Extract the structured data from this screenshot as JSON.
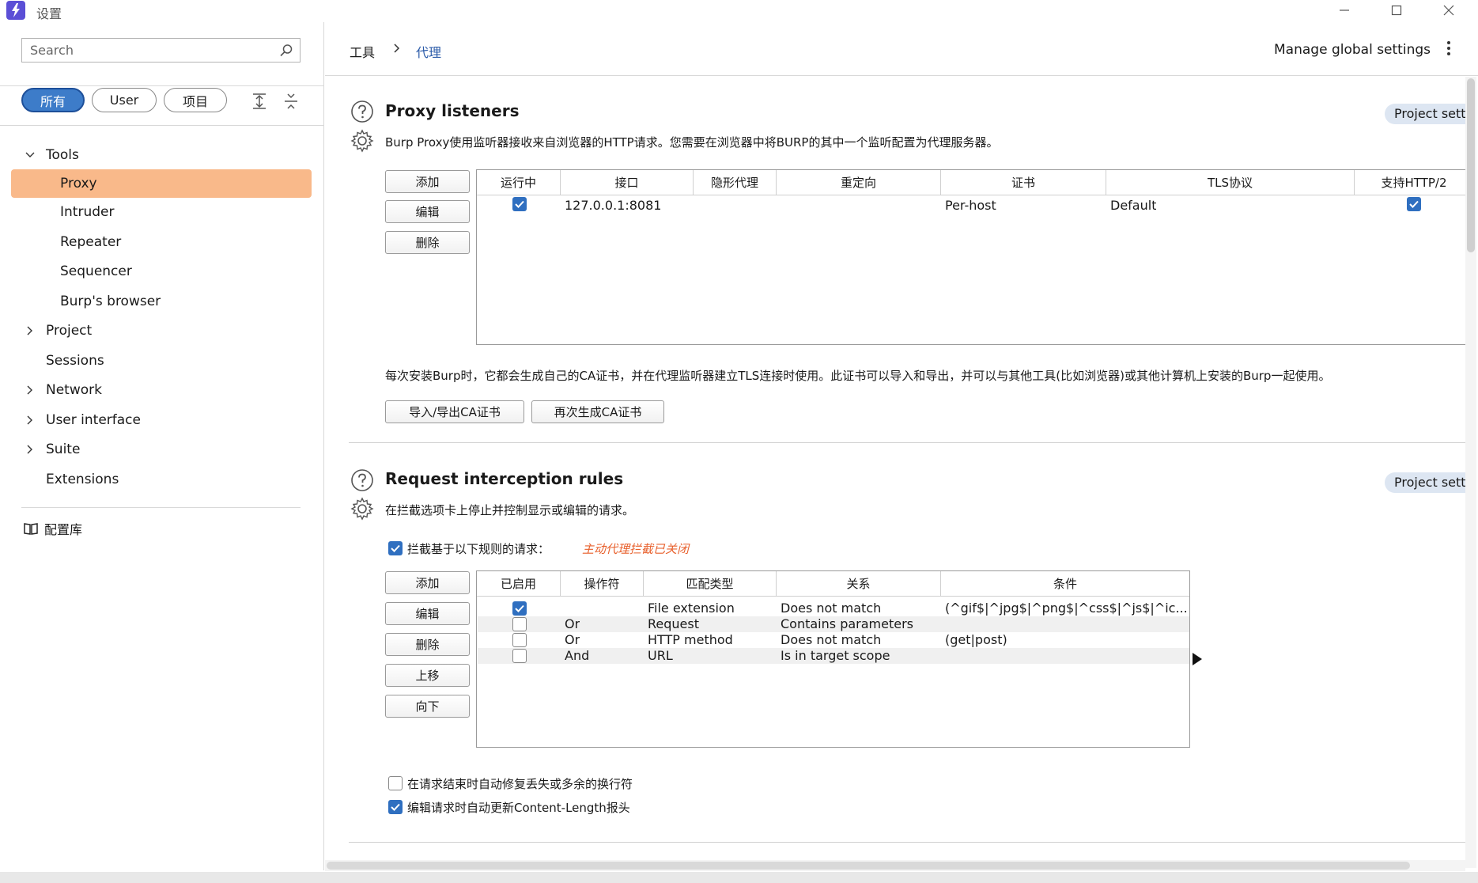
{
  "window": {
    "title": "设置",
    "icon": "burp-lightning-icon",
    "controls": [
      "minimize",
      "maximize",
      "close"
    ]
  },
  "sidebar": {
    "search_placeholder": "Search",
    "filters": [
      {
        "label": "所有",
        "active": true
      },
      {
        "label": "User",
        "active": false
      },
      {
        "label": "项目",
        "active": false
      }
    ],
    "tree": [
      {
        "label": "Tools",
        "expanded": true,
        "selected": false,
        "has_chevron": true,
        "indent": 0
      },
      {
        "label": "Proxy",
        "selected": true,
        "has_chevron": false,
        "indent": 1
      },
      {
        "label": "Intruder",
        "selected": false,
        "has_chevron": false,
        "indent": 1
      },
      {
        "label": "Repeater",
        "selected": false,
        "has_chevron": false,
        "indent": 1
      },
      {
        "label": "Sequencer",
        "selected": false,
        "has_chevron": false,
        "indent": 1
      },
      {
        "label": "Burp's browser",
        "selected": false,
        "has_chevron": false,
        "indent": 1
      },
      {
        "label": "Project",
        "expanded": false,
        "selected": false,
        "has_chevron": true,
        "indent": 0
      },
      {
        "label": "Sessions",
        "selected": false,
        "has_chevron": false,
        "indent": 0
      },
      {
        "label": "Network",
        "expanded": false,
        "selected": false,
        "has_chevron": true,
        "indent": 0
      },
      {
        "label": "User interface",
        "expanded": false,
        "selected": false,
        "has_chevron": true,
        "indent": 0
      },
      {
        "label": "Suite",
        "expanded": false,
        "selected": false,
        "has_chevron": true,
        "indent": 0
      },
      {
        "label": "Extensions",
        "selected": false,
        "has_chevron": false,
        "indent": 0
      }
    ],
    "library_label": "配置库"
  },
  "header": {
    "breadcrumb_root": "工具",
    "breadcrumb_current": "代理",
    "global_settings": "Manage global settings"
  },
  "proxy_listeners": {
    "title": "Proxy listeners",
    "description": "Burp Proxy使用监听器接收来自浏览器的HTTP请求。您需要在浏览器中将BURP的其中一个监听配置为代理服务器。",
    "badge": "Project settings",
    "buttons": {
      "add": "添加",
      "edit": "编辑",
      "remove": "删除"
    },
    "columns": [
      "运行中",
      "接口",
      "隐形代理",
      "重定向",
      "证书",
      "TLS协议",
      "支持HTTP/2"
    ],
    "rows": [
      {
        "running": true,
        "interface": "127.0.0.1:8081",
        "invisible": "",
        "redirect": "",
        "certificate": "Per-host",
        "tls": "Default",
        "http2": true
      }
    ],
    "ca_info": "每次安装Burp时，它都会生成自己的CA证书，并在代理监听器建立TLS连接时使用。此证书可以导入和导出，并可以与其他工具(比如浏览器)或其他计算机上安装的Burp一起使用。",
    "import_export_label": "导入/导出CA证书",
    "regenerate_label": "再次生成CA证书"
  },
  "interception": {
    "title": "Request interception rules",
    "description": "在拦截选项卡上停止并控制显示或编辑的请求。",
    "badge": "Project settings",
    "intercept_label": "拦截基于以下规则的请求：",
    "intercept_checked": true,
    "warning": "主动代理拦截已关闭",
    "buttons": {
      "add": "添加",
      "edit": "编辑",
      "remove": "删除",
      "up": "上移",
      "down": "向下"
    },
    "columns": [
      "已启用",
      "操作符",
      "匹配类型",
      "关系",
      "条件"
    ],
    "rows": [
      {
        "enabled": true,
        "operator": "",
        "match_type": "File extension",
        "relationship": "Does not match",
        "condition": "(^gif$|^jpg$|^png$|^css$|^js$|^ic..."
      },
      {
        "enabled": false,
        "operator": "Or",
        "match_type": "Request",
        "relationship": "Contains parameters",
        "condition": ""
      },
      {
        "enabled": false,
        "operator": "Or",
        "match_type": "HTTP method",
        "relationship": "Does not match",
        "condition": "(get|post)"
      },
      {
        "enabled": false,
        "operator": "And",
        "match_type": "URL",
        "relationship": "Is in target scope",
        "condition": ""
      }
    ],
    "fix_newlines_label": "在请求结束时自动修复丢失或多余的换行符",
    "fix_newlines_checked": false,
    "update_length_label": "编辑请求时自动更新Content-Length报头",
    "update_length_checked": true
  },
  "colors": {
    "accent": "#3d7cc9",
    "selected_item": "#f9b98a",
    "checkbox": "#2f6fc0",
    "warning": "#e8602c",
    "breadcrumb_current": "#2a5aa8"
  }
}
